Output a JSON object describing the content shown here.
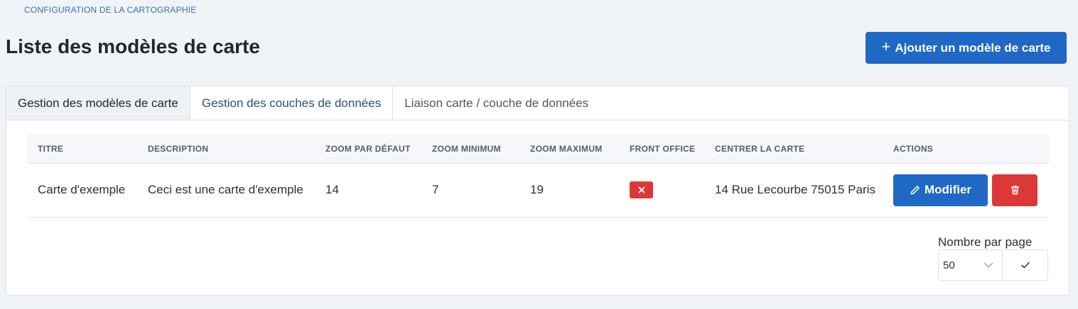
{
  "breadcrumb": "CONFIGURATION DE LA CARTOGRAPHIE",
  "page_title": "Liste des modèles de carte",
  "add_button": {
    "label": "Ajouter un modèle de carte",
    "icon": "plus-icon"
  },
  "tabs": [
    {
      "label": "Gestion des modèles de carte",
      "active": true
    },
    {
      "label": "Gestion des couches de données",
      "active": false
    },
    {
      "label": "Liaison carte / couche de données",
      "active": false
    }
  ],
  "table": {
    "columns": [
      "TITRE",
      "DESCRIPTION",
      "ZOOM PAR DÉFAUT",
      "ZOOM MINIMUM",
      "ZOOM MAXIMUM",
      "FRONT OFFICE",
      "CENTRER LA CARTE",
      "ACTIONS"
    ],
    "rows": [
      {
        "title": "Carte d'exemple",
        "description": "Ceci est une carte d'exemple",
        "zoom_default": "14",
        "zoom_min": "7",
        "zoom_max": "19",
        "front_office": false,
        "center": "14 Rue Lecourbe 75015 Paris",
        "modify_label": "Modifier"
      }
    ]
  },
  "pagination": {
    "per_page_label": "Nombre par page",
    "per_page_value": "50"
  },
  "colors": {
    "primary": "#1f68c6",
    "danger": "#dc3838",
    "background": "#f0f3f8",
    "breadcrumb": "#3a6fb0"
  },
  "icons": {
    "modify": "pencil-icon",
    "delete": "trash-icon",
    "front_office_false": "close-icon",
    "select": "chevron-down-icon",
    "confirm": "check-icon"
  }
}
